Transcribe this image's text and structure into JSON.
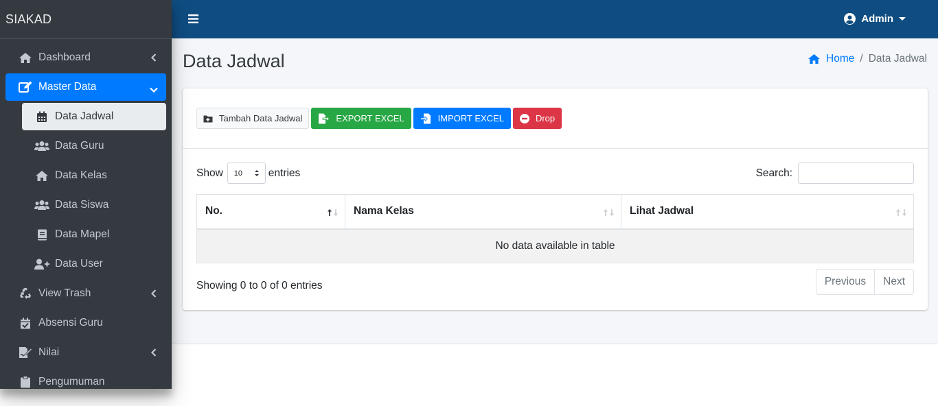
{
  "brand": "SIAKAD",
  "sidebar": {
    "dashboard": "Dashboard",
    "master_data": "Master Data",
    "sub_items": [
      {
        "label": "Data Jadwal",
        "icon": "calendar-icon"
      },
      {
        "label": "Data Guru",
        "icon": "users-icon"
      },
      {
        "label": "Data Kelas",
        "icon": "home-icon"
      },
      {
        "label": "Data Siswa",
        "icon": "users-icon"
      },
      {
        "label": "Data Mapel",
        "icon": "book-icon"
      },
      {
        "label": "Data User",
        "icon": "user-plus-icon"
      }
    ],
    "view_trash": "View Trash",
    "absensi_guru": "Absensi Guru",
    "nilai": "Nilai",
    "pengumuman": "Pengumuman"
  },
  "topbar": {
    "user": "Admin"
  },
  "page": {
    "title": "Data Jadwal",
    "breadcrumb_home": "Home",
    "breadcrumb_sep": "/",
    "breadcrumb_current": "Data Jadwal"
  },
  "toolbar": {
    "add": "Tambah Data Jadwal",
    "export": "EXPORT EXCEL",
    "import": "IMPORT EXCEL",
    "drop": "Drop"
  },
  "datatable": {
    "show_label": "Show",
    "length_value": "10",
    "entries_label": "entries",
    "search_label": "Search:",
    "columns": [
      "No.",
      "Nama Kelas",
      "Lihat Jadwal"
    ],
    "empty": "No data available in table",
    "info": "Showing 0 to 0 of 0 entries",
    "previous": "Previous",
    "next": "Next"
  },
  "colors": {
    "sidebar_bg": "#343a40",
    "topbar_bg": "#0f4c81",
    "active": "#007bff",
    "success": "#28a745",
    "danger": "#dc3545"
  }
}
